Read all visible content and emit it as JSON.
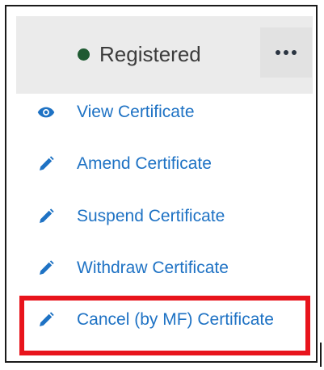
{
  "status": {
    "label": "Registered",
    "dot_color": "#1f5a32"
  },
  "more_button": {
    "icon": "more-horizontal-icon"
  },
  "menu": {
    "items": [
      {
        "label": "View Certificate",
        "icon": "eye-icon"
      },
      {
        "label": "Amend Certificate",
        "icon": "pencil-icon"
      },
      {
        "label": "Suspend Certificate",
        "icon": "pencil-icon"
      },
      {
        "label": "Withdraw Certificate",
        "icon": "pencil-icon"
      },
      {
        "label": "Cancel (by MF) Certificate",
        "icon": "pencil-icon"
      }
    ]
  },
  "colors": {
    "link": "#1e72c4",
    "highlight": "#e8141c",
    "header_bg": "#ebebeb"
  }
}
